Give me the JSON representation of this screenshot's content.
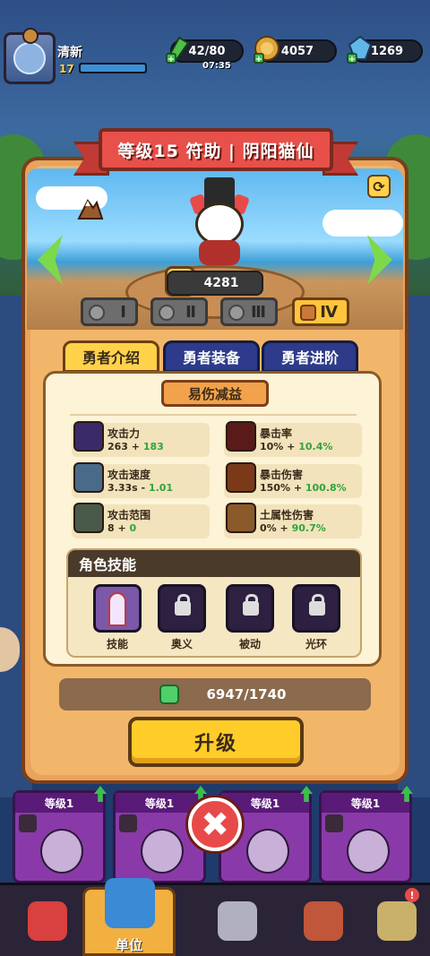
{
  "hud": {
    "player_name": "清新",
    "player_level": "17",
    "energy": "42/80",
    "energy_timer": "07:35",
    "coins": "4057",
    "gems": "1269"
  },
  "hero": {
    "title": "等级15 符助 | 阴阳猫仙",
    "power": "4281",
    "tiers": [
      "Ⅰ",
      "Ⅱ",
      "Ⅲ",
      "Ⅳ"
    ],
    "selected_tier": "Ⅳ"
  },
  "tabs": [
    "勇者介绍",
    "勇者装备",
    "勇者进阶"
  ],
  "active_tab": "勇者介绍",
  "card": {
    "subtitle": "易伤减益",
    "stats": [
      {
        "name": "攻击力",
        "base": "263",
        "op": " + ",
        "bonus": "183",
        "icon": "attack-icon"
      },
      {
        "name": "暴击率",
        "base": "10%",
        "op": " + ",
        "bonus": "10.4%",
        "icon": "crit-rate-icon"
      },
      {
        "name": "攻击速度",
        "base": "3.33s",
        "op": " - ",
        "bonus": "1.01",
        "icon": "attack-speed-icon"
      },
      {
        "name": "暴击伤害",
        "base": "150%",
        "op": " + ",
        "bonus": "100.8%",
        "icon": "crit-damage-icon"
      },
      {
        "name": "攻击范围",
        "base": "8",
        "op": " + ",
        "bonus": "0",
        "icon": "attack-range-icon"
      },
      {
        "name": "土属性伤害",
        "base": "0%",
        "op": " + ",
        "bonus": "90.7%",
        "icon": "earth-damage-icon"
      }
    ],
    "skills_title": "角色技能",
    "skills": [
      {
        "label": "技能",
        "locked": false
      },
      {
        "label": "奥义",
        "locked": true
      },
      {
        "label": "被动",
        "locked": true
      },
      {
        "label": "光环",
        "locked": true
      }
    ]
  },
  "cost": "6947/1740",
  "upgrade_label": "升级",
  "units": [
    {
      "label": "等级1"
    },
    {
      "label": "等级1"
    },
    {
      "label": "等级1"
    },
    {
      "label": "等级1"
    }
  ],
  "nav": {
    "active_label": "单位",
    "notification": "!"
  },
  "colors": {
    "banner": "#e8504a",
    "upgrade": "#ffcc2a",
    "bonus_green": "#2fa53a",
    "active_tab": "#ffd24a"
  }
}
